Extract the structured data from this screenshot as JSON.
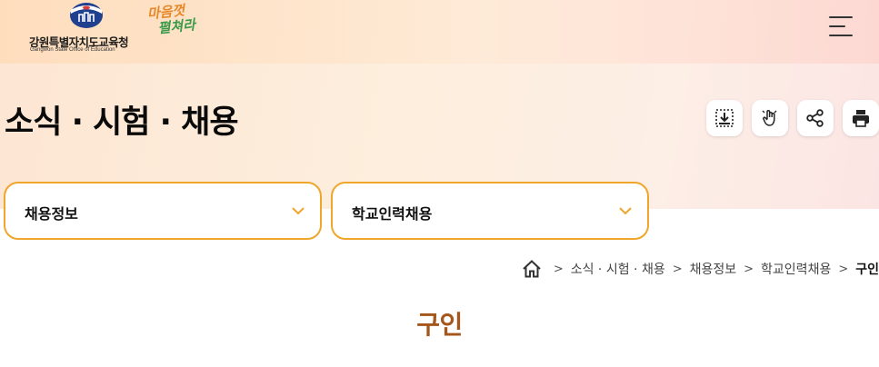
{
  "header": {
    "org_name": "강원특별자치도교육청",
    "org_name_en": "Gangwon State Office of Education",
    "slogan_line1": "마음껏",
    "slogan_line2": "펼쳐라",
    "menu_icon": "hamburger-menu-icon"
  },
  "page": {
    "title": "소식 · 시험 · 채용",
    "tools": [
      {
        "name": "download-icon"
      },
      {
        "name": "hand-touch-icon"
      },
      {
        "name": "share-icon"
      },
      {
        "name": "print-icon"
      }
    ]
  },
  "filters": {
    "category": "채용정보",
    "subcategory": "학교인력채용"
  },
  "breadcrumb": {
    "items": [
      "소식 · 시험 · 채용",
      "채용정보",
      "학교인력채용"
    ],
    "current": "구인"
  },
  "section": {
    "title": "구인"
  },
  "colors": {
    "accent_border": "#f0a52b",
    "section_title": "#a5561a"
  }
}
